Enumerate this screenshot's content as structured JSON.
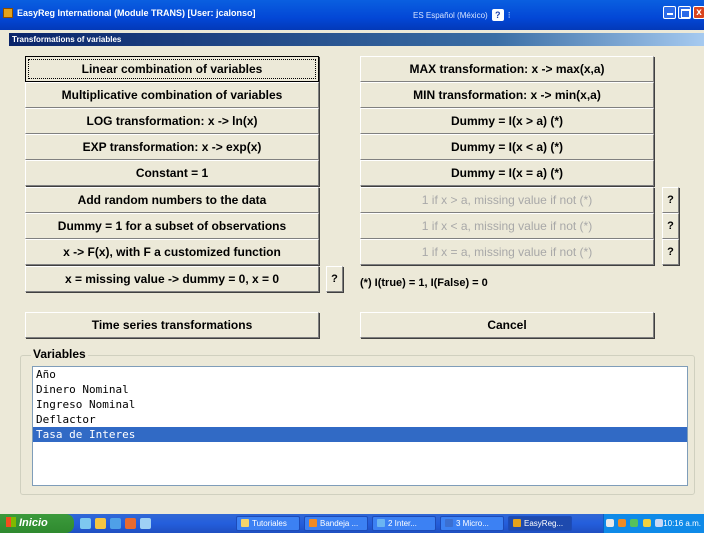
{
  "window": {
    "title": "EasyReg International (Module TRANS) [User: jcalonso]",
    "language_indicator": "ES Español (México)",
    "help_glyph": "?",
    "language_options_glyph": "⁝",
    "close_glyph": "x"
  },
  "dialog": {
    "title": "Transformations of variables"
  },
  "left_buttons": [
    "Linear combination of variables",
    "Multiplicative combination of variables",
    "LOG transformation: x -> ln(x)",
    "EXP transformation: x -> exp(x)",
    "Constant = 1",
    "Add random numbers to the data",
    "Dummy = 1 for a subset of observations",
    "x -> F(x), with F a customized function",
    "x = missing value -> dummy = 0, x = 0"
  ],
  "right_buttons": [
    "MAX transformation: x -> max(x,a)",
    "MIN transformation: x -> min(x,a)",
    "Dummy =  I(x > a)  (*)",
    "Dummy = I(x < a)  (*)",
    "Dummy = I(x = a) (*)"
  ],
  "right_disabled_buttons": [
    "1 if x > a, missing value if not (*)",
    "1 if x < a, missing value if not (*)",
    "1 if x = a, missing value if not (*)"
  ],
  "help_button_label": "?",
  "note": "(*) I(true) = 1, I(False) = 0",
  "bottom_buttons": {
    "time_series": "Time series transformations",
    "cancel": "Cancel"
  },
  "variables": {
    "label": "Variables",
    "items": [
      "Año",
      "Dinero Nominal",
      "Ingreso Nominal",
      "Deflactor",
      "Tasa de Interes"
    ],
    "selected_index": 4
  },
  "taskbar": {
    "start_label": "Inicio",
    "tasks": [
      "Tutoriales",
      "Bandeja ...",
      "2 Inter...",
      "3 Micro...",
      "EasyReg..."
    ],
    "active_task_index": 4,
    "clock": "10:16 a.m."
  },
  "colors": {
    "titlebar": "#0347D6",
    "dialog_face": "#ECE9D8",
    "selection": "#316AC5",
    "taskbar": "#245EDC",
    "start_button": "#2F8A2F"
  }
}
